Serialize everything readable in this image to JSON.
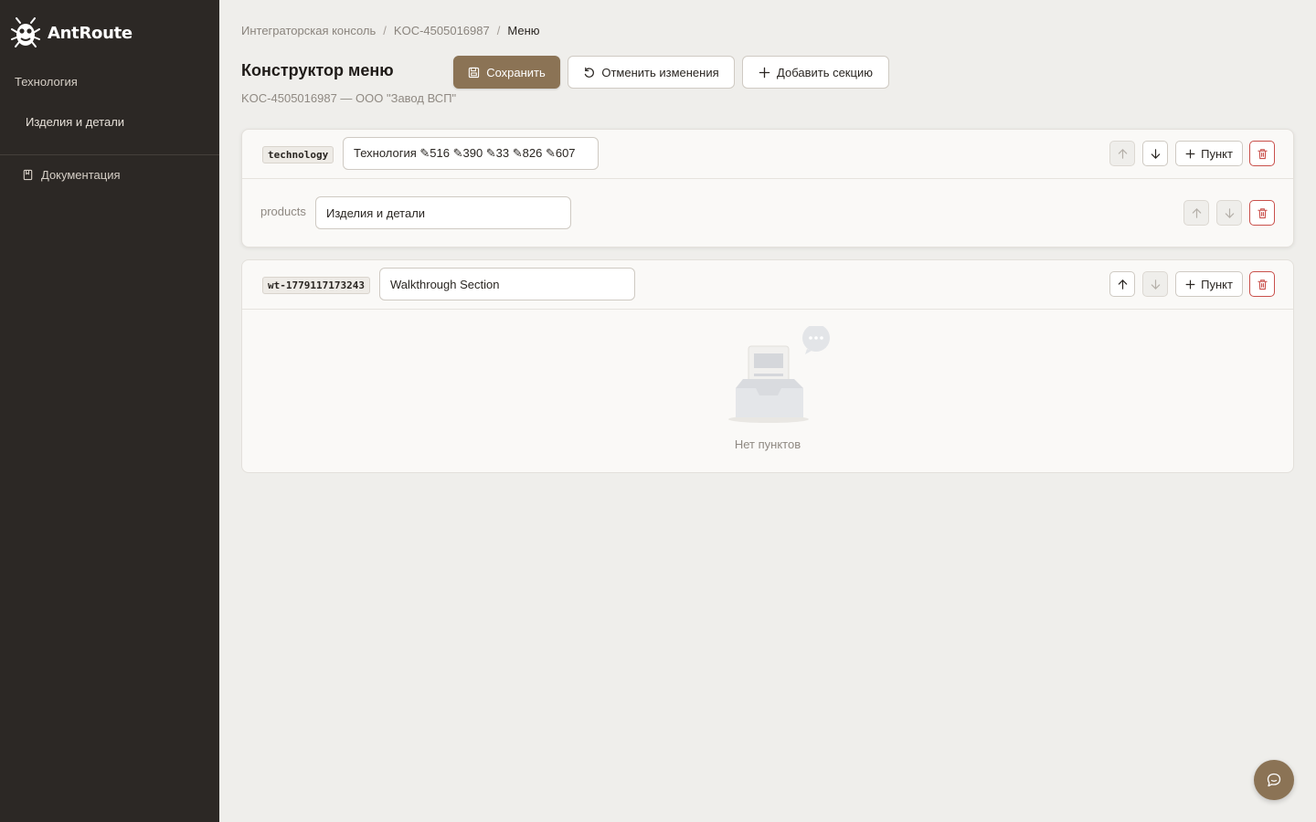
{
  "app": {
    "name": "AntRoute",
    "logo_icon": "ant-logo-icon"
  },
  "sidebar": {
    "group_label": "Технология",
    "items": [
      {
        "label": "Изделия и детали"
      }
    ],
    "docs": {
      "label": "Документация",
      "icon": "document-icon"
    }
  },
  "breadcrumb": {
    "items": [
      "Интеграторская консоль",
      "KOC-4505016987",
      "Меню"
    ],
    "separator": "/"
  },
  "header": {
    "title": "Конструктор меню",
    "subtitle": "KOC-4505016987 — ООО \"Завод ВСП\""
  },
  "toolbar": {
    "save_label": "Сохранить",
    "revert_label": "Отменить изменения",
    "add_section_label": "Добавить секцию"
  },
  "sections": [
    {
      "key": "technology",
      "title": "Технология ✎516 ✎390 ✎33 ✎826 ✎607",
      "add_item_label": "Пункт",
      "move_up_enabled": false,
      "move_down_enabled": true,
      "items": [
        {
          "key": "products",
          "title": "Изделия и детали",
          "move_up_enabled": false,
          "move_down_enabled": false
        }
      ]
    },
    {
      "key": "wt-1779117173243",
      "title": "Walkthrough Section",
      "add_item_label": "Пункт",
      "move_up_enabled": true,
      "move_down_enabled": false,
      "items": [],
      "empty_text": "Нет пунктов"
    }
  ],
  "colors": {
    "sidebar_bg": "#2c2825",
    "accent": "#8b7355",
    "danger": "#c9504b",
    "page_bg": "#efeeeb"
  },
  "chat": {
    "icon": "chat-bubble-icon"
  }
}
